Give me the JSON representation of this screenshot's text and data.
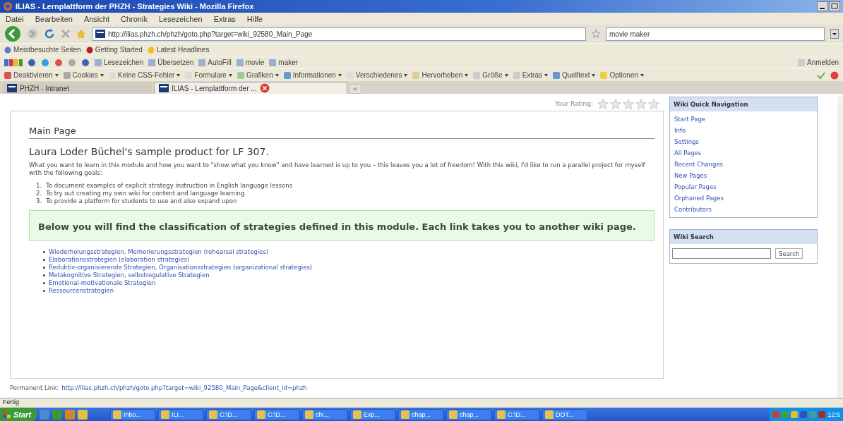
{
  "window": {
    "title": "ILIAS - Lernplattform der PHZH - Strategies Wiki - Mozilla Firefox"
  },
  "menu": [
    "Datei",
    "Bearbeiten",
    "Ansicht",
    "Chronik",
    "Lesezeichen",
    "Extras",
    "Hilfe"
  ],
  "address_bar": {
    "value": "http://ilias.phzh.ch/phzh/goto.php?target=wiki_92580_Main_Page"
  },
  "search_bar": {
    "value": "movie maker"
  },
  "bookmarks": [
    "Meistbesuchte Seiten",
    "Getting Started",
    "Latest Headlines"
  ],
  "google_toolbar": {
    "items": [
      "Lesezeichen",
      "Übersetzen",
      "AutoFill",
      "movie",
      "maker"
    ],
    "sign_in": "Anmelden"
  },
  "developer_toolbar": [
    "Deaktivieren",
    "Cookies",
    "Keine CSS-Fehler",
    "Formulare",
    "Grafiken",
    "Informationen",
    "Verschiedenes",
    "Hervorheben",
    "Größe",
    "Extras",
    "Quelltext",
    "Optionen"
  ],
  "tabs": [
    {
      "label": "PHZH - Intranet",
      "selected": false
    },
    {
      "label": "ILIAS - Lernplattform der ...",
      "selected": true
    }
  ],
  "rating": {
    "label": "Your Rating:",
    "stars": 0
  },
  "page": {
    "title": "Main Page",
    "heading": "Laura Loder Büchel's sample product for LF 307.",
    "intro": "What you want to learn in this module and how you want to \"show what you know\" and have learned is up to you – this leaves you a lot of freedom! With this wiki, I'd like to run a parallel project for myself with the following goals:",
    "goals": [
      {
        "number": "1.",
        "text": "To document examples of explicit strategy instruction in English language lessons"
      },
      {
        "number": "2.",
        "text": "To try out creating my own wiki for content and language learning"
      },
      {
        "number": "3.",
        "text": "To provide a platform for students to use and also expand upon"
      }
    ],
    "callout": "Below you will find the classification of strategies defined in this module. Each link takes you to another wiki page.",
    "links": [
      "Wiederholungsstrategien, Memorierungsstrategien (rehearsal strategies)",
      "Elaborationsstrategien (elaboration strategies)",
      "Reduktiv-organisierende Strategien, Organisationsstrategien (organizational strategies)",
      "Metakognitive Strategien, selbstregulative Strategien",
      "Emotional-motivationale Strategien",
      "Ressourcenstrategien"
    ]
  },
  "quick_navigation": {
    "title": "Wiki Quick Navigation",
    "items": [
      "Start Page",
      "Info",
      "Settings",
      "All Pages",
      "Recent Changes",
      "New Pages",
      "Popular Pages",
      "Orphaned Pages",
      "Contributors"
    ]
  },
  "wiki_search": {
    "title": "Wiki Search",
    "button": "Search"
  },
  "permanent_link": {
    "label": "Permanent Link:",
    "url": "http://ilias.phzh.ch/phzh/goto.php?target=wiki_92580_Main_Page&client_id=phzh"
  },
  "status_bar": "Fertig",
  "taskbar": {
    "start": "Start",
    "buttons": [
      "Inbo...",
      "ILI...",
      "C:\\D...",
      "C:\\D...",
      "chi...",
      "Exp...",
      "chap...",
      "chap...",
      "C:\\D...",
      "DOT..."
    ],
    "clock": "12:5"
  }
}
